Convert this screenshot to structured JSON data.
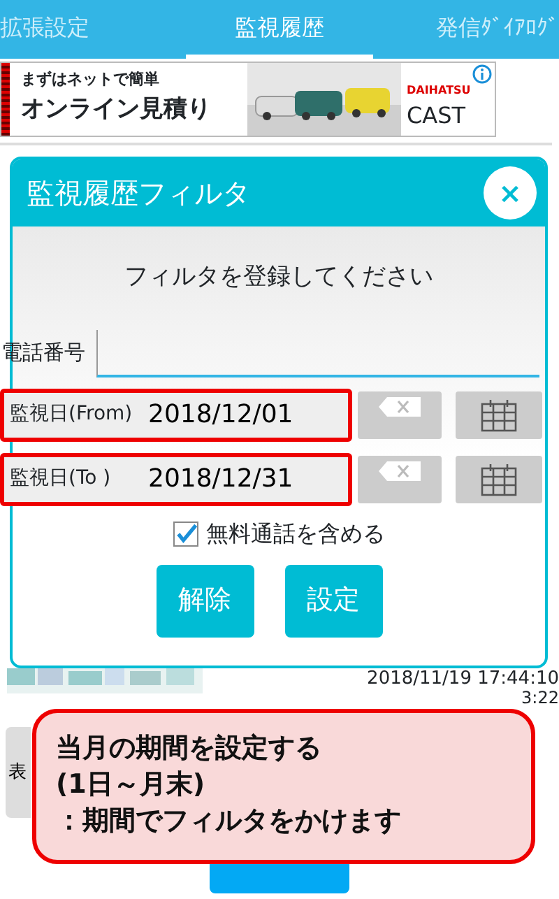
{
  "tabs": [
    {
      "label": "拡張設定",
      "selected": false
    },
    {
      "label": "監視履歴",
      "selected": true
    },
    {
      "label": "発信ﾀﾞｲｱﾛｸﾞ",
      "selected": false
    }
  ],
  "ad": {
    "headline": "まずはネットで簡単",
    "title": "オンライン見積り",
    "maker": "DAIHATSU",
    "model": "CAST"
  },
  "background": {
    "timestamp": "2018/11/19 17:44:10",
    "time": "3:22",
    "side_button": "表"
  },
  "dialog": {
    "title": "監視履歴フィルタ",
    "close": "×",
    "message": "フィルタを登録してください",
    "phone": {
      "label": "電話番号"
    },
    "dates": [
      {
        "label": "監視日(From)",
        "value": "2018/12/01",
        "highlighted": true
      },
      {
        "label": "監視日(To )",
        "value": "2018/12/31",
        "highlighted": true
      }
    ],
    "checkbox": {
      "label": "無料通話を含める",
      "checked": true
    },
    "buttons": [
      "解除",
      "設定"
    ]
  },
  "callout": {
    "lines": [
      "当月の期間を設定する",
      "(1日～月末)",
      "：期間でフィルタをかけます"
    ]
  }
}
